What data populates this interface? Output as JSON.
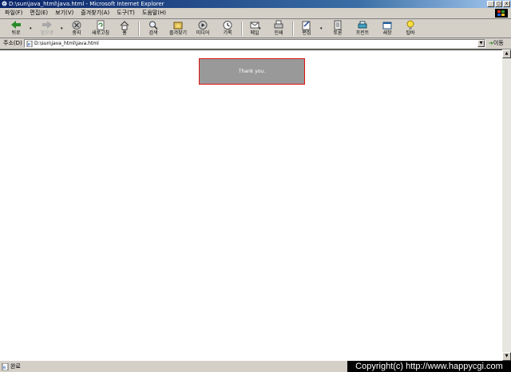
{
  "window": {
    "title": "D:\\sun\\java_html\\java.html - Microsoft Internet Explorer",
    "controls": [
      "_",
      "□",
      "x"
    ]
  },
  "menu": [
    "파일(F)",
    "편집(E)",
    "보기(V)",
    "즐겨찾기(A)",
    "도구(T)",
    "도움말(H)"
  ],
  "toolbar": {
    "back": "뒤로",
    "forward": "앞으로",
    "stop": "중지",
    "refresh": "새로고침",
    "home": "홈",
    "search": "검색",
    "favorites": "즐겨찾기",
    "media": "미디어",
    "history": "기록",
    "mail": "메일",
    "print": "인쇄",
    "edit": "편집",
    "discuss": "토론",
    "printer": "프린트",
    "messenger": "새창",
    "tips": "팁바"
  },
  "address": {
    "label": "주소(D)",
    "value": "D:\\sun\\java_html\\java.html",
    "go_label": "이동"
  },
  "page": {
    "banner_text": "Thank you."
  },
  "status": {
    "text": "완료"
  },
  "overlay": {
    "copyright": "Copyright(c) http://www.happycgi.com"
  },
  "colors": {
    "titlebar": "#0a246a",
    "banner_bg": "#999999",
    "banner_border": "#e01010"
  }
}
